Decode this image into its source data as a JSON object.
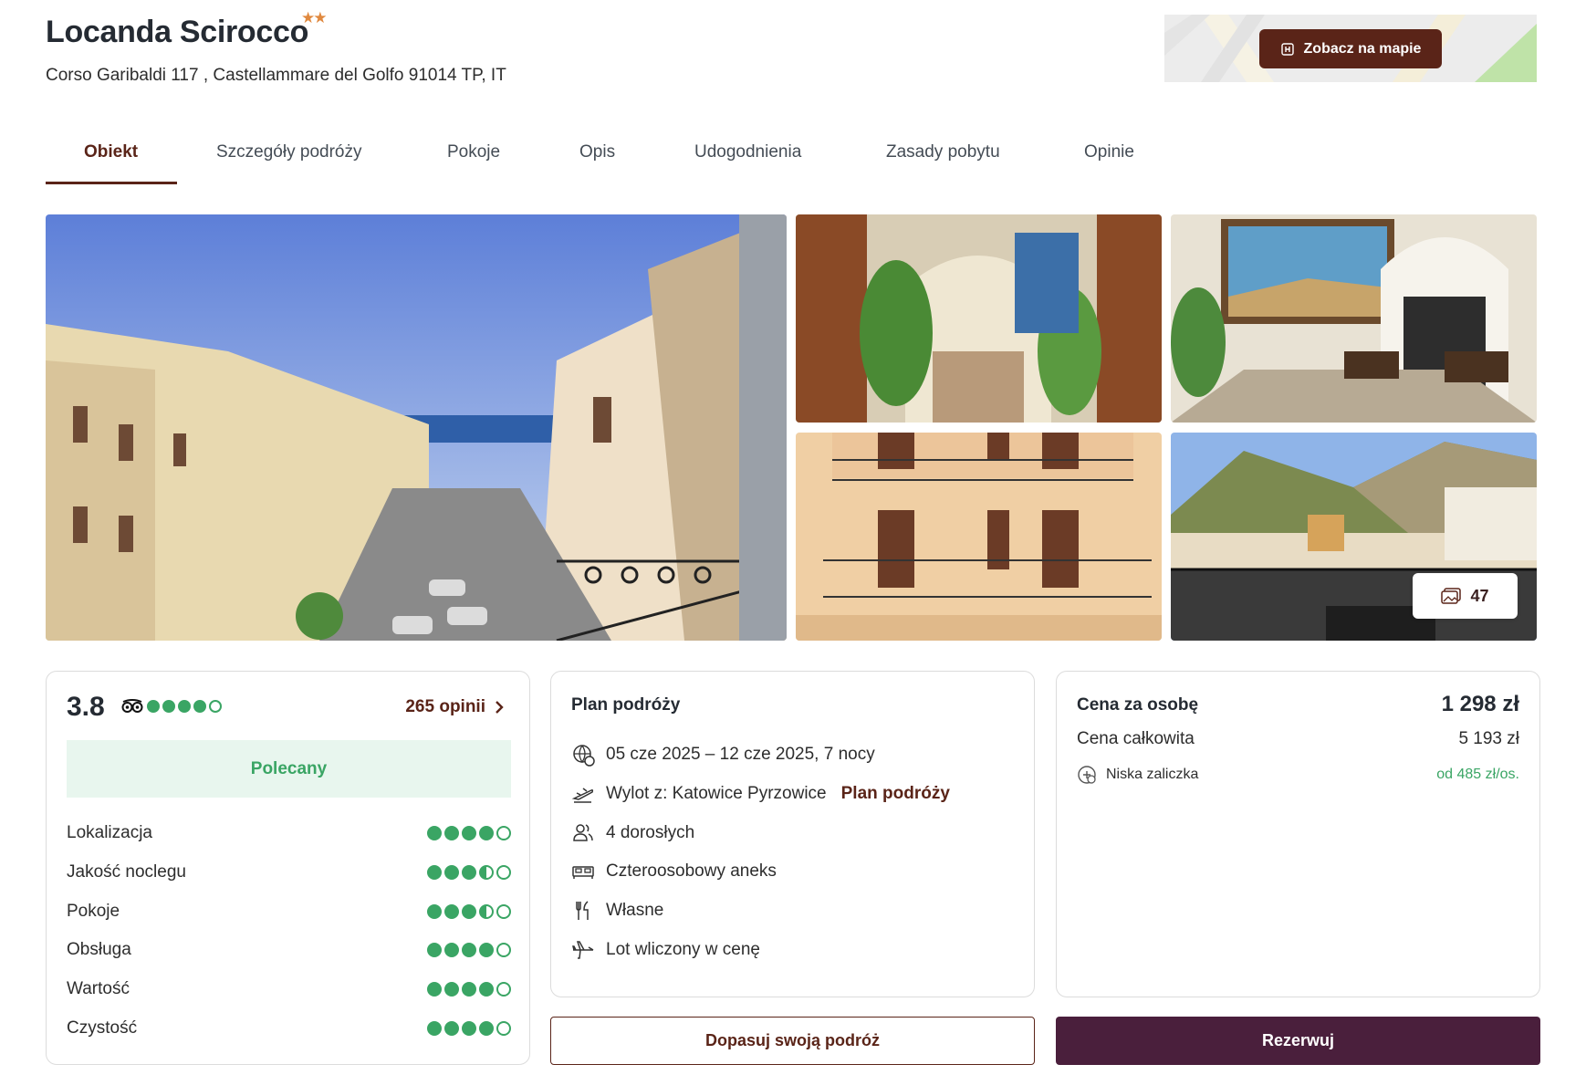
{
  "hotel": {
    "name": "Locanda Scirocco",
    "stars": "★★",
    "address": "Corso Garibaldi 117 , Castellammare del Golfo 91014 TP, IT"
  },
  "map": {
    "button_label": "Zobacz na mapie"
  },
  "tabs": [
    {
      "label": "Obiekt"
    },
    {
      "label": "Szczegóły podróży"
    },
    {
      "label": "Pokoje"
    },
    {
      "label": "Opis"
    },
    {
      "label": "Udogodnienia"
    },
    {
      "label": "Zasady pobytu"
    },
    {
      "label": "Opinie"
    }
  ],
  "gallery": {
    "photo_count": "47"
  },
  "rating": {
    "score": "3.8",
    "tripadvisor_level": 4,
    "opinions_label": "265 opinii",
    "badge": "Polecany",
    "categories": [
      {
        "label": "Lokalizacja",
        "value": 4
      },
      {
        "label": "Jakość noclegu",
        "value": 3.5
      },
      {
        "label": "Pokoje",
        "value": 3.5
      },
      {
        "label": "Obsługa",
        "value": 4
      },
      {
        "label": "Wartość",
        "value": 4
      },
      {
        "label": "Czystość",
        "value": 4
      }
    ]
  },
  "plan": {
    "title": "Plan podróży",
    "dates": "05 cze 2025 – 12 cze 2025, 7 nocy",
    "departure": "Wylot z: Katowice Pyrzowice",
    "departure_link": "Plan podróży",
    "guests": "4 dorosłych",
    "room": "Czteroosobowy aneks",
    "board": "Własne",
    "flight": "Lot wliczony w cenę"
  },
  "price": {
    "per_person_label": "Cena za osobę",
    "per_person_value": "1 298 zł",
    "total_label": "Cena całkowita",
    "total_value": "5 193 zł",
    "deposit_label": "Niska zaliczka",
    "deposit_value": "od 485 zł/os."
  },
  "actions": {
    "customize_label": "Dopasuj swoją podróż",
    "book_label": "Rezerwuj"
  },
  "colors": {
    "brand": "#5a2418",
    "book_button": "#4a1f3c",
    "rating_green": "#3aa564"
  }
}
